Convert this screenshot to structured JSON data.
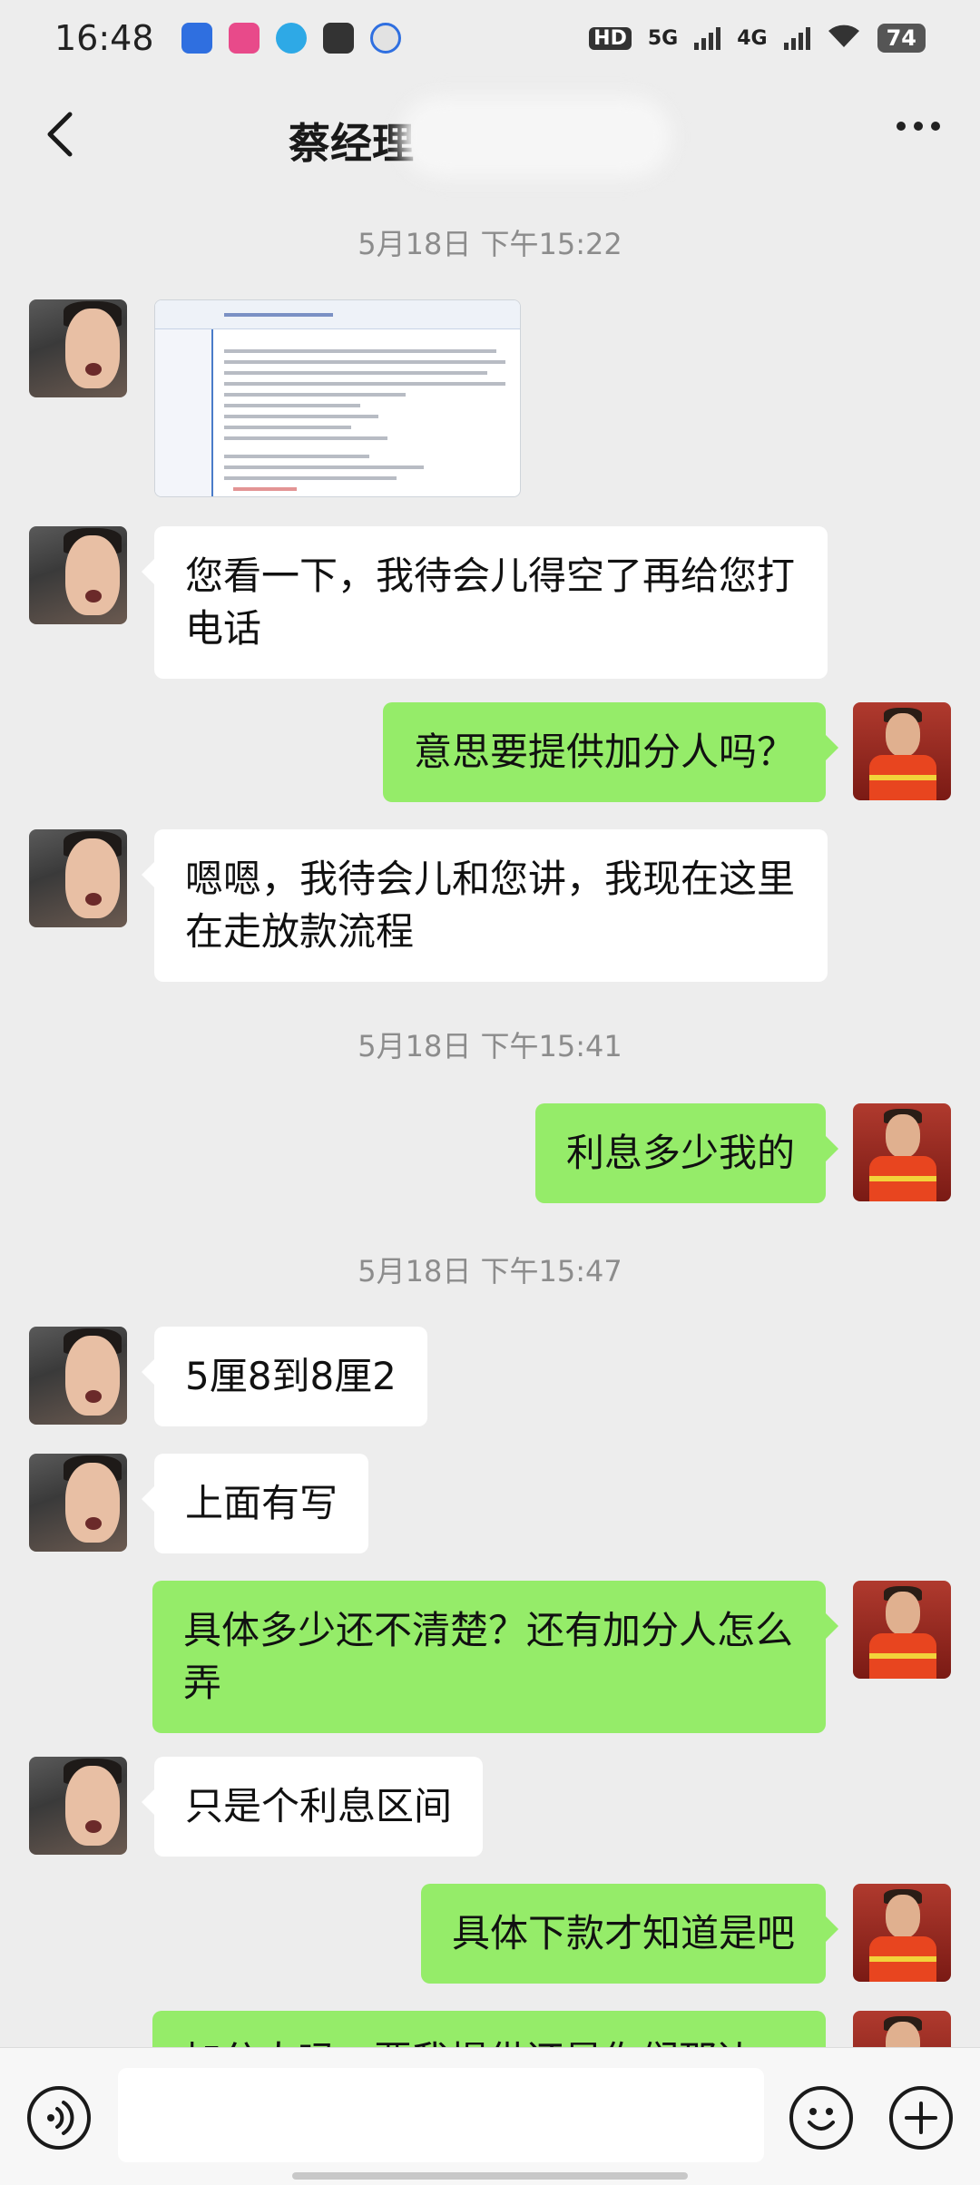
{
  "status_bar": {
    "time": "16:48",
    "hd": "HD",
    "net1": "5G",
    "net2": "4G",
    "battery": "74"
  },
  "header": {
    "title": "蔡经理",
    "back_icon": "chevron-left-icon",
    "more_icon": "more-dots-icon"
  },
  "timestamps": [
    "5月18日 下午15:22",
    "5月18日 下午15:41",
    "5月18日 下午15:47"
  ],
  "messages": [
    {
      "side": "left",
      "type": "image"
    },
    {
      "side": "left",
      "text": "您看一下，我待会儿得空了再给您打电话"
    },
    {
      "side": "right",
      "text": "意思要提供加分人吗？"
    },
    {
      "side": "left",
      "text": "嗯嗯，我待会儿和您讲，我现在这里在走放款流程"
    },
    {
      "side": "right",
      "text": "利息多少我的"
    },
    {
      "side": "left",
      "text": "5厘8到8厘2"
    },
    {
      "side": "left",
      "text": "上面有写"
    },
    {
      "side": "right",
      "text": "具体多少还不清楚？还有加分人怎么弄"
    },
    {
      "side": "left",
      "text": "只是个利息区间"
    },
    {
      "side": "right",
      "text": "具体下款才知道是吧"
    },
    {
      "side": "right",
      "text": "加分人吗，要我提供还是你们那边"
    }
  ],
  "input_bar": {
    "voice_icon": "voice-icon",
    "emoji_icon": "emoji-icon",
    "plus_icon": "plus-icon",
    "placeholder": ""
  }
}
